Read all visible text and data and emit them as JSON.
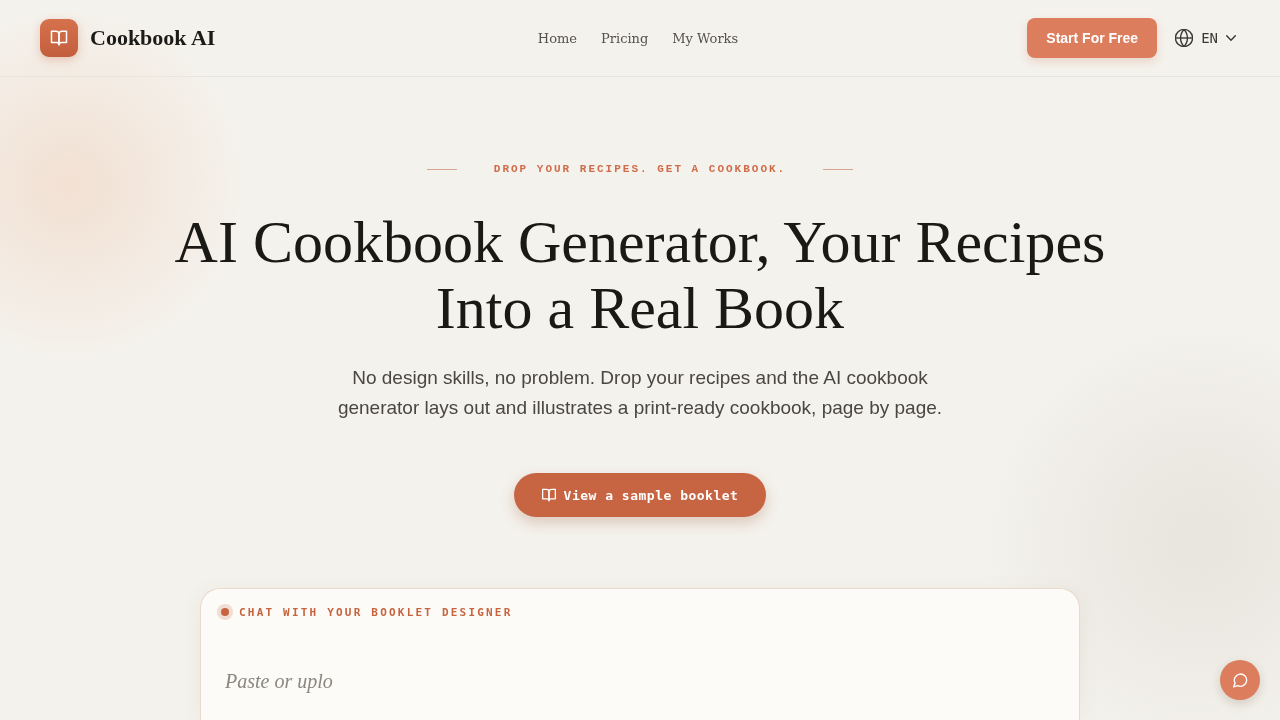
{
  "header": {
    "brand": "Cookbook AI",
    "nav": [
      "Home",
      "Pricing",
      "My Works"
    ],
    "cta": "Start For Free",
    "language": "EN"
  },
  "hero": {
    "eyebrow": "DROP YOUR RECIPES. GET A COOKBOOK.",
    "title": "AI Cookbook Generator, Your Recipes Into a Real Book",
    "subtitle": "No design skills, no problem. Drop your recipes and the AI cookbook generator lays out and illustrates a print-ready cookbook, page by page.",
    "button": "View a sample booklet"
  },
  "chat": {
    "label": "CHAT WITH YOUR BOOKLET DESIGNER",
    "placeholder": "Paste or uplo"
  }
}
